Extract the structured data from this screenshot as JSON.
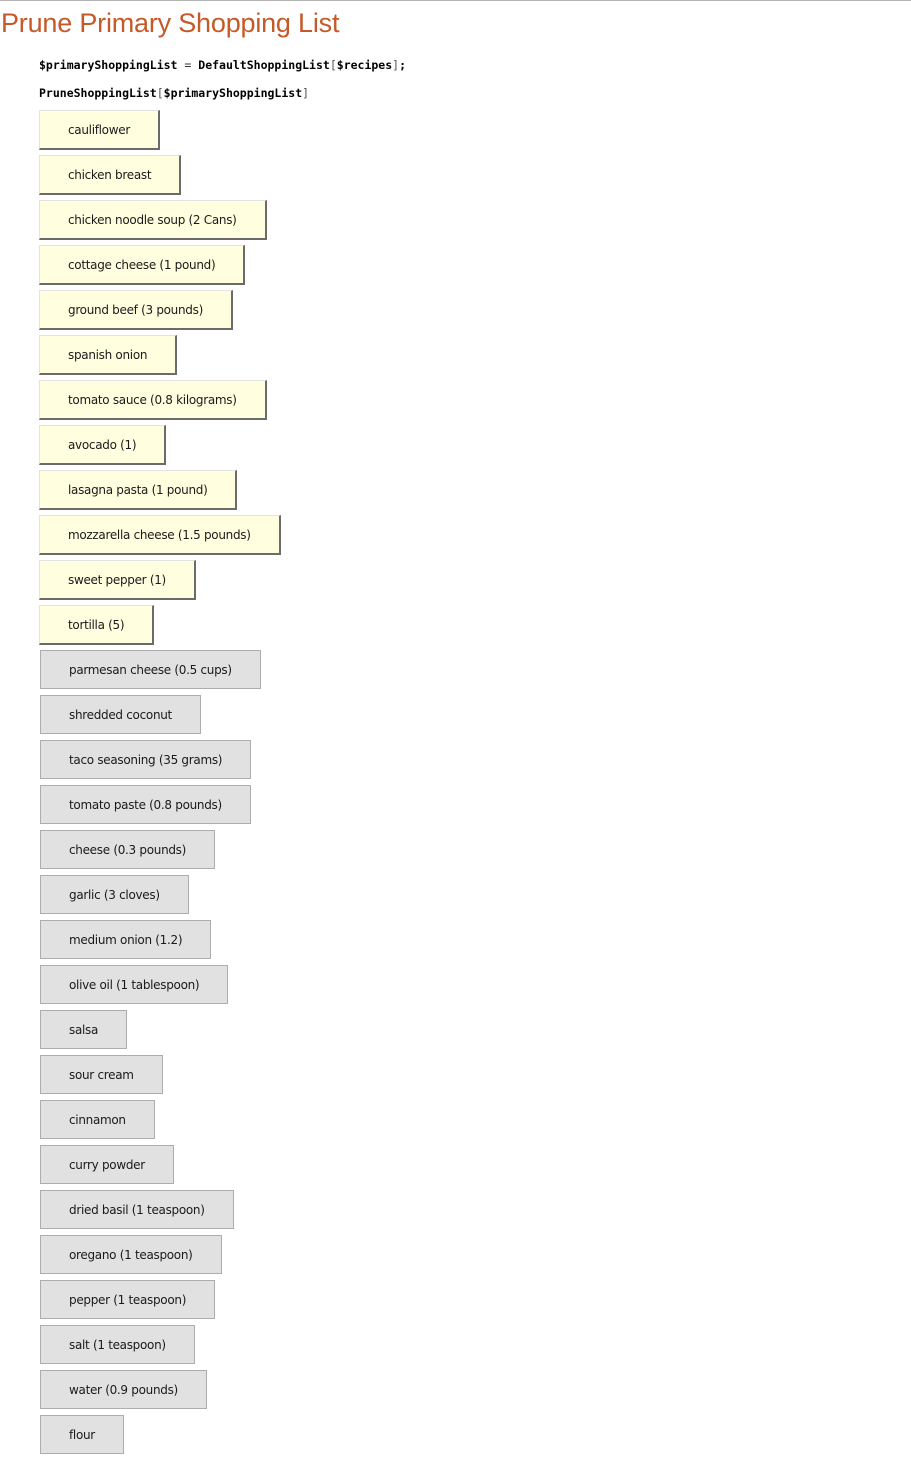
{
  "section": {
    "title": "Prune Primary Shopping List"
  },
  "code": {
    "line1": {
      "var": "$primaryShoppingList",
      "op": " = ",
      "fn": "DefaultShoppingList",
      "open": "[",
      "arg": "$recipes",
      "close": "]",
      "end": ";"
    },
    "line2": {
      "fn": "PruneShoppingList",
      "open": "[",
      "arg": "$primaryShoppingList",
      "close": "]"
    }
  },
  "colors": {
    "title": "#c55a28",
    "selected_fill": "#ffffe0",
    "unselected_fill": "#e1e1e1"
  },
  "items": [
    {
      "label": "cauliflower",
      "selected": true
    },
    {
      "label": "chicken breast",
      "selected": true
    },
    {
      "label": "chicken noodle soup (2 Cans)",
      "selected": true
    },
    {
      "label": "cottage cheese (1 pound)",
      "selected": true
    },
    {
      "label": "ground beef (3 pounds)",
      "selected": true
    },
    {
      "label": "spanish onion",
      "selected": true
    },
    {
      "label": "tomato sauce (0.8 kilograms)",
      "selected": true
    },
    {
      "label": "avocado (1)",
      "selected": true
    },
    {
      "label": "lasagna pasta (1 pound)",
      "selected": true
    },
    {
      "label": "mozzarella cheese (1.5 pounds)",
      "selected": true
    },
    {
      "label": "sweet pepper (1)",
      "selected": true
    },
    {
      "label": "tortilla (5)",
      "selected": true
    },
    {
      "label": "parmesan cheese (0.5 cups)",
      "selected": false
    },
    {
      "label": "shredded coconut",
      "selected": false
    },
    {
      "label": "taco seasoning (35 grams)",
      "selected": false
    },
    {
      "label": "tomato paste (0.8 pounds)",
      "selected": false
    },
    {
      "label": "cheese (0.3 pounds)",
      "selected": false
    },
    {
      "label": "garlic (3 cloves)",
      "selected": false
    },
    {
      "label": "medium onion (1.2)",
      "selected": false
    },
    {
      "label": "olive oil (1 tablespoon)",
      "selected": false
    },
    {
      "label": "salsa",
      "selected": false
    },
    {
      "label": "sour cream",
      "selected": false
    },
    {
      "label": "cinnamon",
      "selected": false
    },
    {
      "label": "curry powder",
      "selected": false
    },
    {
      "label": "dried basil (1 teaspoon)",
      "selected": false
    },
    {
      "label": "oregano (1 teaspoon)",
      "selected": false
    },
    {
      "label": "pepper (1 teaspoon)",
      "selected": false
    },
    {
      "label": "salt (1 teaspoon)",
      "selected": false
    },
    {
      "label": "water (0.9 pounds)",
      "selected": false
    },
    {
      "label": "flour",
      "selected": false
    }
  ]
}
